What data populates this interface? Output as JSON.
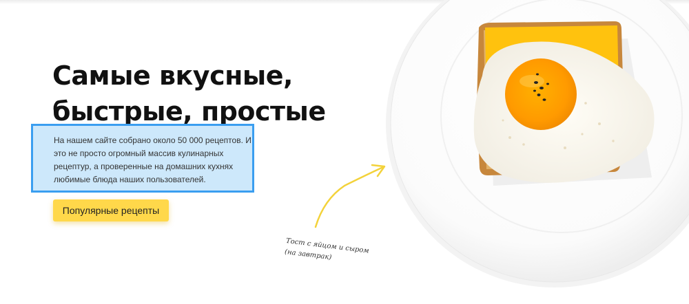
{
  "hero": {
    "headline_part1": "Самые ",
    "headline_highlight": "вкусные",
    "headline_part2": ",",
    "headline_line2": "быстрые, простые",
    "description": "На нашем сайте собрано около 50 000 рецептов. И это не просто огромный массив кулинарных рецептур, а проверенные на домашних кухнях любимые блюда наших пользователей.",
    "cta_label": "Популярные рецепты"
  },
  "caption": {
    "line1": "Тост с яйцом и сыром",
    "line2": "(на завтрак)"
  },
  "colors": {
    "accent_yellow": "#ffd84a",
    "selection_blue": "#3a9ef0",
    "selection_fill": "#cde8fb",
    "headline": "#111111"
  },
  "icons": {
    "arrow": "hand-drawn-arrow-icon"
  }
}
